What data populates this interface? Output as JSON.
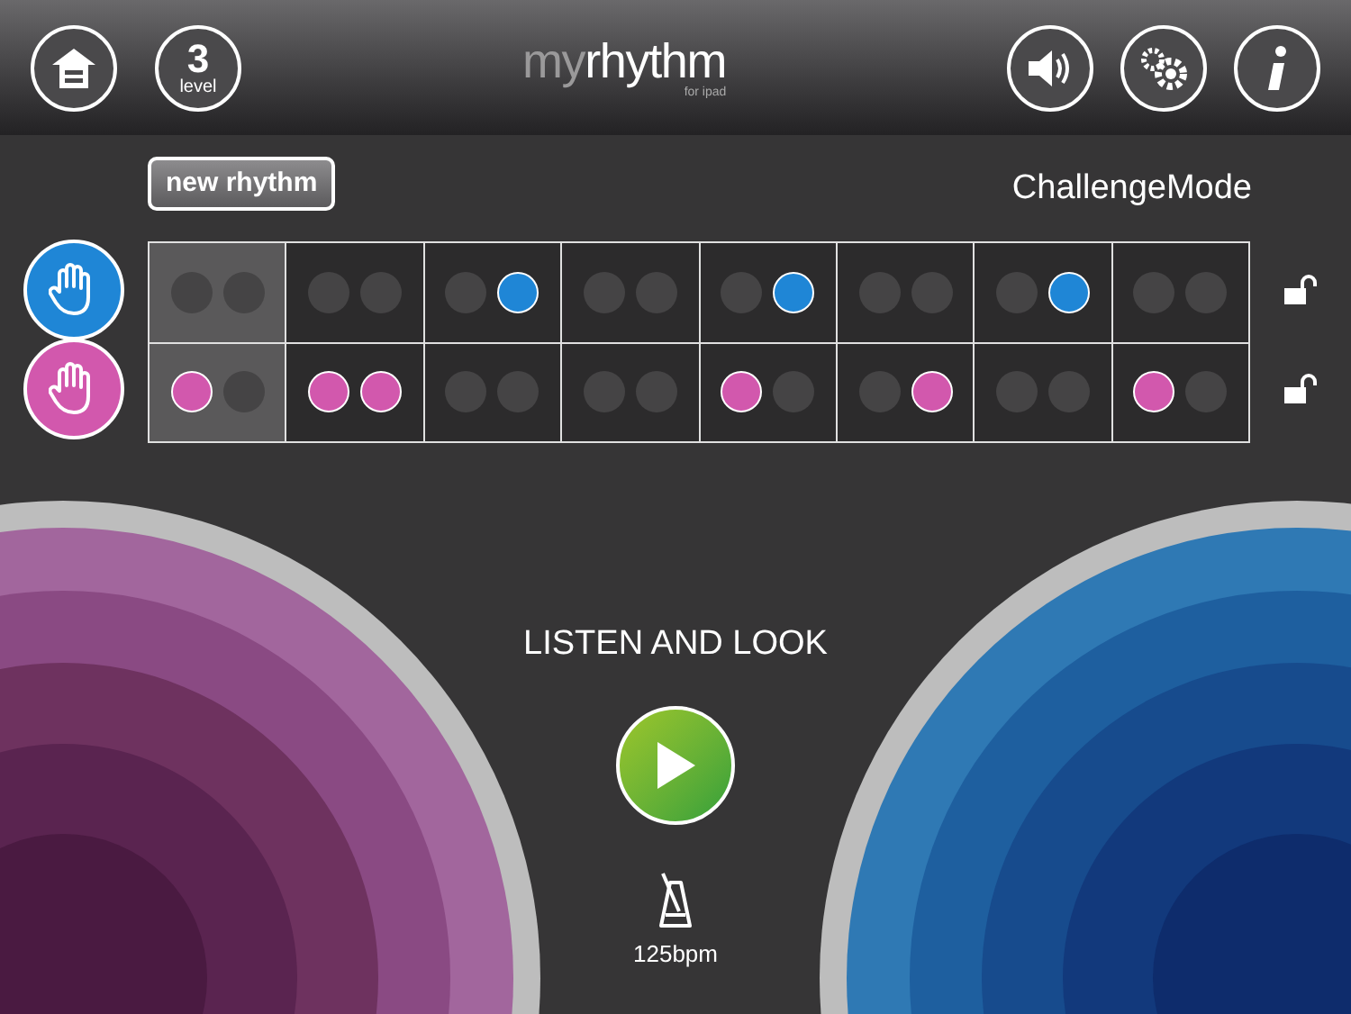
{
  "header": {
    "level": "3",
    "level_label": "level",
    "logo_my": "my",
    "logo_rhythm": "rhythm",
    "logo_sub": "for ipad"
  },
  "new_rhythm_button": "new rhythm",
  "mode": "ChallengeMode",
  "tracks": [
    {
      "color": "#1f86d6",
      "locked": false,
      "steps": [
        {
          "selected": true,
          "beats": [
            false,
            false
          ]
        },
        {
          "selected": false,
          "beats": [
            false,
            false
          ]
        },
        {
          "selected": false,
          "beats": [
            false,
            true
          ]
        },
        {
          "selected": false,
          "beats": [
            false,
            false
          ]
        },
        {
          "selected": false,
          "beats": [
            false,
            true
          ]
        },
        {
          "selected": false,
          "beats": [
            false,
            false
          ]
        },
        {
          "selected": false,
          "beats": [
            false,
            true
          ]
        },
        {
          "selected": false,
          "beats": [
            false,
            false
          ]
        }
      ]
    },
    {
      "color": "#d258ad",
      "locked": false,
      "steps": [
        {
          "selected": true,
          "beats": [
            true,
            false
          ]
        },
        {
          "selected": false,
          "beats": [
            true,
            true
          ]
        },
        {
          "selected": false,
          "beats": [
            false,
            false
          ]
        },
        {
          "selected": false,
          "beats": [
            false,
            false
          ]
        },
        {
          "selected": false,
          "beats": [
            true,
            false
          ]
        },
        {
          "selected": false,
          "beats": [
            false,
            true
          ]
        },
        {
          "selected": false,
          "beats": [
            false,
            false
          ]
        },
        {
          "selected": false,
          "beats": [
            true,
            false
          ]
        }
      ]
    }
  ],
  "prompt": "LISTEN AND LOOK",
  "tempo": "125bpm"
}
